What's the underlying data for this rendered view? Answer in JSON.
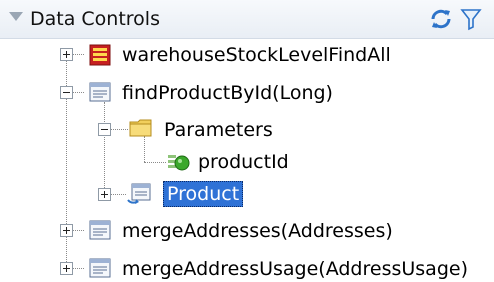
{
  "panel": {
    "title": "Data Controls"
  },
  "tree": {
    "items": [
      {
        "label": "warehouseStockLevelFindAll"
      },
      {
        "label": "findProductById(Long)"
      },
      {
        "label": "Parameters"
      },
      {
        "label": "productId"
      },
      {
        "label": "Product"
      },
      {
        "label": "mergeAddresses(Addresses)"
      },
      {
        "label": "mergeAddressUsage(AddressUsage)"
      }
    ]
  },
  "icons": {
    "header": [
      "refresh-icon",
      "filter-icon"
    ],
    "nodes": [
      "stacked-bars-icon",
      "method-icon",
      "folder-icon",
      "parameter-cube-icon",
      "return-object-icon",
      "method-icon",
      "method-icon"
    ]
  },
  "colors": {
    "selection": "#2f72d6",
    "folder": "#f2cf5c",
    "parameter": "#3ba82b"
  }
}
